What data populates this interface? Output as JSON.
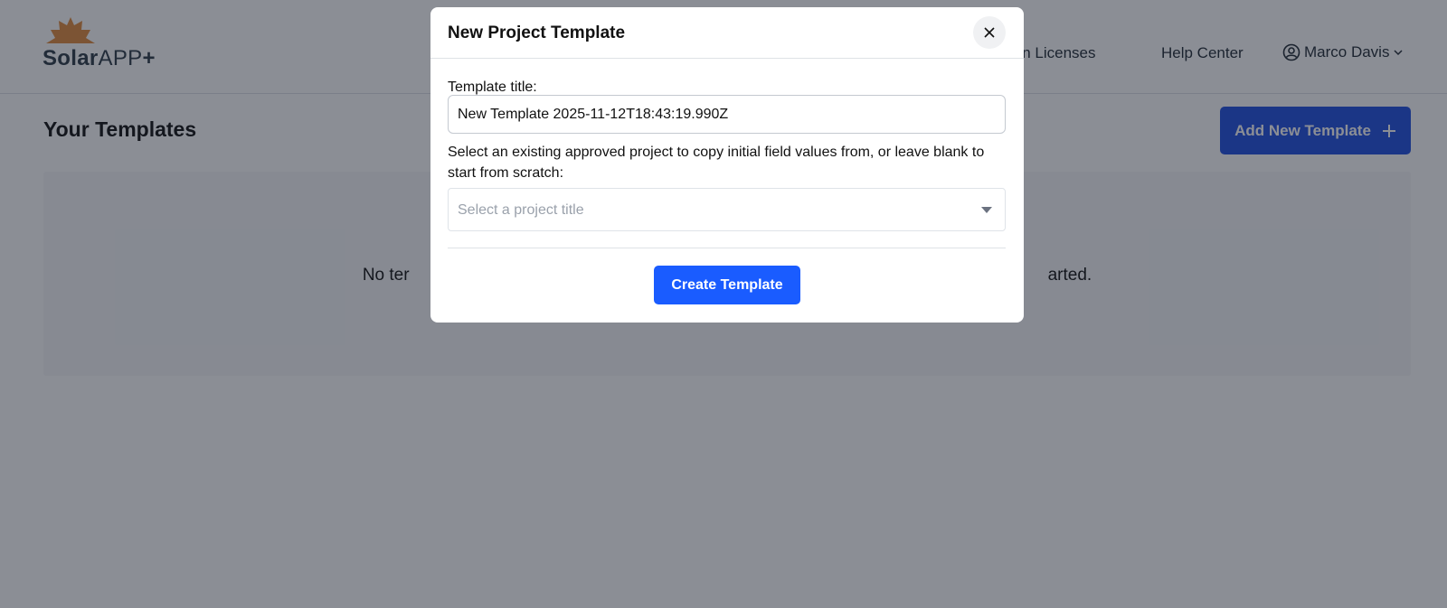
{
  "header": {
    "logo": {
      "word1": "Solar",
      "word2": "APP",
      "word3": "+"
    },
    "nav": {
      "licenses_label": "iction Licenses",
      "help_label": "Help Center"
    },
    "user": {
      "name": "Marco Davis",
      "icon": "user-circle-icon"
    }
  },
  "main": {
    "title": "Your Templates",
    "add_button_label": "Add New Template",
    "empty_left": "No ter",
    "empty_right": "arted."
  },
  "modal": {
    "title": "New Project Template",
    "close_icon": "close-icon",
    "title_label": "Template title:",
    "title_value": "New Template 2025-11-12T18:43:19.990Z",
    "project_label": "Select an existing approved project to copy initial field values from, or leave blank to start from scratch:",
    "project_placeholder": "Select a project title",
    "create_button_label": "Create Template"
  },
  "colors": {
    "primary": "#1a5cff",
    "logo_sun": "#e08a3c",
    "overlay": "rgba(23,29,44,0.5)"
  }
}
